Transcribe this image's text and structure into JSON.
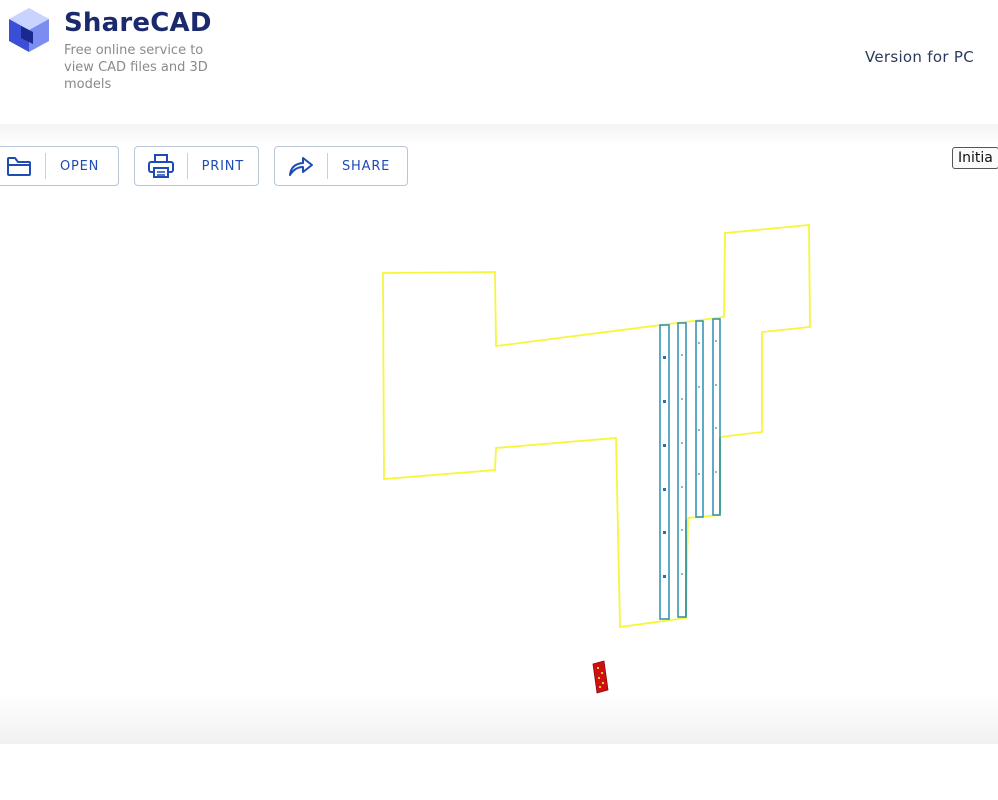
{
  "header": {
    "brand_name": "ShareCAD",
    "tagline": "Free online service to view CAD files and 3D models",
    "version_link": "Version for PC"
  },
  "toolbar": {
    "open_label": "OPEN",
    "print_label": "PRINT",
    "share_label": "SHARE",
    "initial_view_label": "Initia"
  },
  "drawing": {
    "outline_color": "#f6f63a",
    "column_color": "#2a8fb0",
    "accent_green": "#3aa03a",
    "marker_color": "#d01010",
    "marker_fill": "#e8d020"
  },
  "icons": {
    "logo": "sharecad-cube-logo",
    "open": "folder-icon",
    "print": "printer-icon",
    "share": "share-arrow-icon"
  }
}
